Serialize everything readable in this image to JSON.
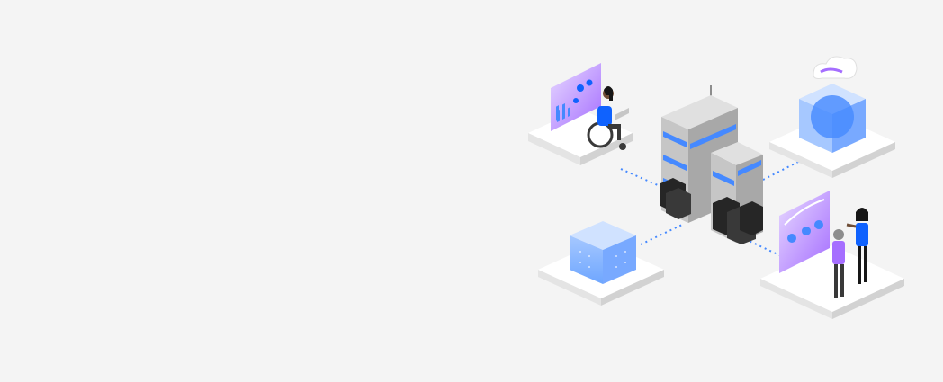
{
  "illustration": {
    "scene": "hybrid-cloud-isometric",
    "icons": [
      "building-icon",
      "server-rack-icon",
      "cloud-cube-icon",
      "grid-cube-icon",
      "dashboard-panel-icon",
      "wheelchair-user-icon",
      "analysts-icon"
    ]
  },
  "colors": {
    "background": "#f4f4f4",
    "platform_top": "#ffffff",
    "platform_left": "#e4e4e4",
    "platform_right": "#d2d2d2",
    "blue": "#4589ff",
    "blue_dark": "#0f62fe",
    "purple": "#a56eff",
    "purple_light": "#d4bbff",
    "connector": "#4589ff",
    "server": "#262626",
    "building_light": "#e0e0e0",
    "building_mid": "#c6c6c6",
    "building_dark": "#a8a8a8"
  }
}
